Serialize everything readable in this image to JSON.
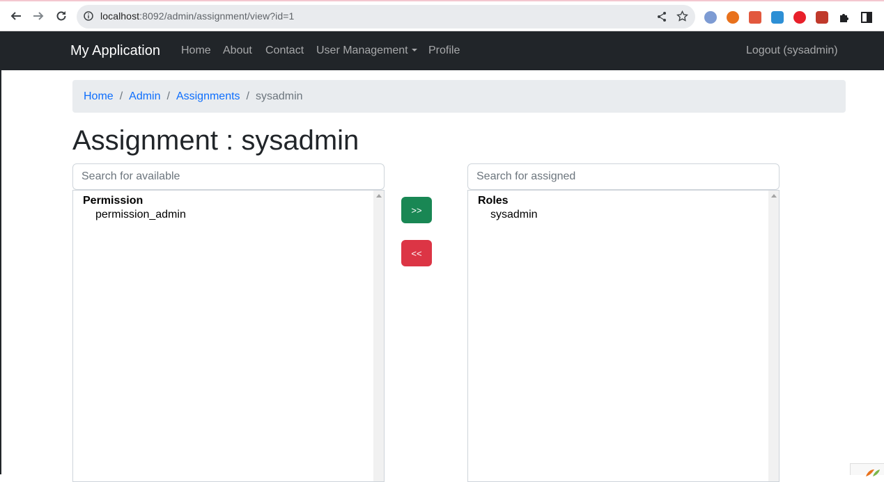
{
  "browser": {
    "url_host": "localhost",
    "url_rest": ":8092/admin/assignment/view?id=1"
  },
  "navbar": {
    "brand": "My Application",
    "items": [
      {
        "label": "Home"
      },
      {
        "label": "About"
      },
      {
        "label": "Contact"
      },
      {
        "label": "User Management"
      },
      {
        "label": "Profile"
      }
    ],
    "logout": "Logout (sysadmin)"
  },
  "breadcrumb": {
    "items": [
      "Home",
      "Admin",
      "Assignments"
    ],
    "active": "sysadmin"
  },
  "page": {
    "title": "Assignment : sysadmin"
  },
  "available": {
    "placeholder": "Search for available",
    "group": "Permission",
    "options": [
      "permission_admin"
    ]
  },
  "assigned": {
    "placeholder": "Search for assigned",
    "group": "Roles",
    "options": [
      "sysadmin"
    ]
  },
  "buttons": {
    "assign": ">>",
    "remove": "<<",
    "assign_color": "#198754",
    "remove_color": "#dc3545"
  },
  "colors": {
    "navbar_bg": "#212529",
    "link": "#0d6efd"
  }
}
